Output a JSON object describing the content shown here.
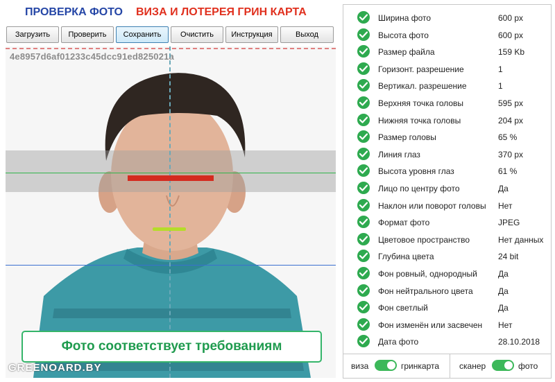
{
  "header": {
    "title_left": "ПРОВЕРКА ФОТО",
    "title_right": "ВИЗА И ЛОТЕРЕЯ ГРИН КАРТА"
  },
  "toolbar": {
    "load": "Загрузить",
    "check": "Проверить",
    "save": "Сохранить",
    "clear": "Очистить",
    "instruction": "Инструкция",
    "exit": "Выход"
  },
  "photo": {
    "hash": "4e8957d6af01233c45dcc91ed825021a",
    "result": "Фото соответствует требованиям",
    "watermark": "GREENOARD.BY"
  },
  "checks": [
    {
      "label": "Ширина фото",
      "value": "600 px",
      "status": "ok"
    },
    {
      "label": "Высота фото",
      "value": "600 px",
      "status": "ok"
    },
    {
      "label": "Размер файла",
      "value": "159 Kb",
      "status": "ok"
    },
    {
      "label": "Горизонт. разрешение",
      "value": "1",
      "status": "ok"
    },
    {
      "label": "Вертикал. разрешение",
      "value": "1",
      "status": "ok"
    },
    {
      "label": "Верхняя точка головы",
      "value": "595 px",
      "status": "ok"
    },
    {
      "label": "Нижняя точка головы",
      "value": "204 px",
      "status": "ok"
    },
    {
      "label": "Размер головы",
      "value": "65 %",
      "status": "ok"
    },
    {
      "label": "Линия глаз",
      "value": "370 px",
      "status": "ok"
    },
    {
      "label": "Высота уровня глаз",
      "value": "61 %",
      "status": "ok"
    },
    {
      "label": "Лицо по центру фото",
      "value": "Да",
      "status": "ok"
    },
    {
      "label": "Наклон или поворот головы",
      "value": "Нет",
      "status": "ok"
    },
    {
      "label": "Формат фото",
      "value": "JPEG",
      "status": "ok"
    },
    {
      "label": "Цветовое пространство",
      "value": "Нет данных",
      "status": "ok"
    },
    {
      "label": "Глубина цвета",
      "value": "24 bit",
      "status": "ok"
    },
    {
      "label": "Фон ровный, однородный",
      "value": "Да",
      "status": "ok"
    },
    {
      "label": "Фон нейтрального цвета",
      "value": "Да",
      "status": "ok"
    },
    {
      "label": "Фон светлый",
      "value": "Да",
      "status": "ok"
    },
    {
      "label": "Фон изменён или засвечен",
      "value": "Нет",
      "status": "ok"
    },
    {
      "label": "Дата фото",
      "value": "28.10.2018",
      "status": "ok"
    }
  ],
  "toggles": {
    "mode_left": "виза",
    "mode_right": "гринкарта",
    "mode_on": true,
    "source_left": "сканер",
    "source_right": "фото",
    "source_on": true
  },
  "colors": {
    "accent_blue": "#2546a6",
    "accent_red": "#e0301e",
    "ok_green": "#2eaa4f",
    "eye_line": "#d42a1e",
    "mouth_line": "#b5dc2a",
    "guide_green": "#2fb54a",
    "guide_blue": "#3a6fd0"
  }
}
